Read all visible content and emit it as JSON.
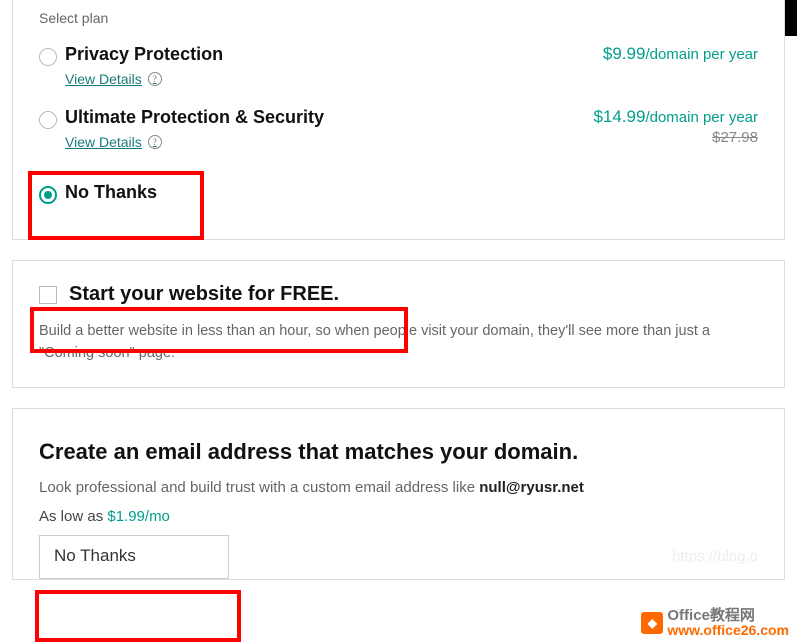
{
  "plans": {
    "section_label": "Select plan",
    "items": [
      {
        "title": "Privacy Protection",
        "details_label": "View Details",
        "price": "$9.99",
        "price_suffix": "/domain per year",
        "strike": ""
      },
      {
        "title": "Ultimate Protection & Security",
        "details_label": "View Details",
        "price": "$14.99",
        "price_suffix": "/domain per year",
        "strike": "$27.98"
      },
      {
        "title": "No Thanks",
        "details_label": "",
        "price": "",
        "price_suffix": "",
        "strike": ""
      }
    ]
  },
  "website_upsell": {
    "checkbox_label": "Start your website for FREE.",
    "description": "Build a better website in less than an hour, so when people visit your domain, they'll see more than just a \"Coming soon\" page."
  },
  "email_upsell": {
    "title": "Create an email address that matches your domain.",
    "description_pre": "Look professional and build trust with a custom email address like ",
    "description_bold": "null@ryusr.net",
    "low_as_pre": "As low as ",
    "low_as_price": "$1.99/mo",
    "dropdown_value": "No Thanks",
    "url_hint": "https://blog.o"
  },
  "watermark": {
    "badge_icon": "◆",
    "line1": "Office教程网",
    "line2": "www.office26.com"
  }
}
